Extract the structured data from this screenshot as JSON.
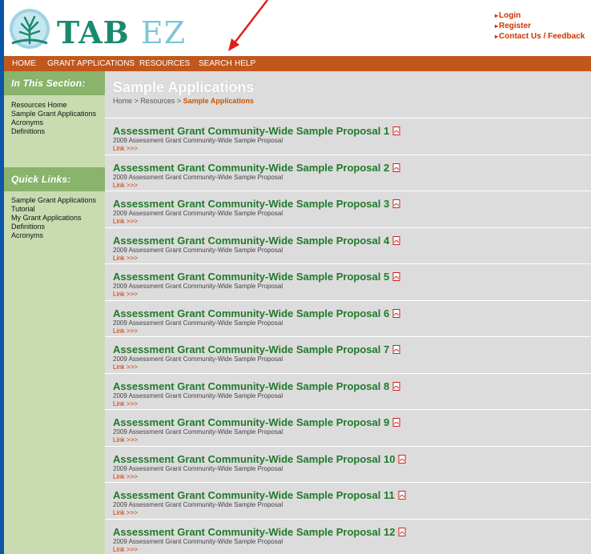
{
  "header": {
    "logo_main": "TAB",
    "logo_ez": "EZ",
    "top_links": [
      "Login",
      "Register",
      "Contact Us / Feedback"
    ]
  },
  "nav": {
    "items": [
      "HOME",
      "GRANT APPLICATIONS",
      "RESOURCES",
      "SEARCH",
      "HELP"
    ]
  },
  "sidebar": {
    "section_heading": "In This Section:",
    "section_links": [
      "Resources Home",
      "Sample Grant Applications",
      "Acronyms",
      "Definitions"
    ],
    "quick_heading": "Quick Links:",
    "quick_links": [
      "Sample Grant Applications",
      "Tutorial",
      "My Grant Applications",
      "Definitions",
      "Acronyms"
    ]
  },
  "main": {
    "title": "Sample Applications",
    "breadcrumb": {
      "home": "Home",
      "sep": ">",
      "resources": "Resources",
      "current": "Sample Applications"
    },
    "items": [
      {
        "title": "Assessment Grant Community-Wide Sample Proposal 1",
        "desc": "2009 Assessment Grant Community-Wide Sample Proposal",
        "link": "Link >>>"
      },
      {
        "title": "Assessment Grant Community-Wide Sample Proposal 2",
        "desc": "2009 Assessment Grant Community-Wide Sample Proposal",
        "link": "Link >>>"
      },
      {
        "title": "Assessment Grant Community-Wide Sample Proposal 3",
        "desc": "2009 Assessment Grant Community-Wide Sample Proposal",
        "link": "Link >>>"
      },
      {
        "title": "Assessment Grant Community-Wide Sample Proposal 4",
        "desc": "2009 Assessment Grant Community-Wide Sample Proposal",
        "link": "Link >>>"
      },
      {
        "title": "Assessment Grant Community-Wide Sample Proposal 5",
        "desc": "2009 Assessment Grant Community-Wide Sample Proposal",
        "link": "Link >>>"
      },
      {
        "title": "Assessment Grant Community-Wide Sample Proposal 6",
        "desc": "2009 Assessment Grant Community-Wide Sample Proposal",
        "link": "Link >>>"
      },
      {
        "title": "Assessment Grant Community-Wide Sample Proposal 7",
        "desc": "2009 Assessment Grant Community-Wide Sample Proposal",
        "link": "Link >>>"
      },
      {
        "title": "Assessment Grant Community-Wide Sample Proposal 8",
        "desc": "2009 Assessment Grant Community-Wide Sample Proposal",
        "link": "Link >>>"
      },
      {
        "title": "Assessment Grant Community-Wide Sample Proposal 9",
        "desc": "2009 Assessment Grant Community-Wide Sample Proposal",
        "link": "Link >>>"
      },
      {
        "title": "Assessment Grant Community-Wide Sample Proposal 10",
        "desc": "2009 Assessment Grant Community-Wide Sample Proposal",
        "link": "Link >>>"
      },
      {
        "title": "Assessment Grant Community-Wide Sample Proposal 11",
        "desc": "2009 Assessment Grant Community-Wide Sample Proposal",
        "link": "Link >>>"
      },
      {
        "title": "Assessment Grant Community-Wide Sample Proposal 12",
        "desc": "2009 Assessment Grant Community-Wide Sample Proposal",
        "link": "Link >>>"
      }
    ]
  },
  "colors": {
    "outer_border": "#0b56a8",
    "nav_bg": "#c2571d",
    "sidebar_bg": "#c8dcb0",
    "sidebar_heading_bg": "#8ab36c",
    "content_bg": "#dcdcdc",
    "item_title": "#1f7a2a",
    "link_red": "#cc3300"
  },
  "icons": {
    "logo": "tree-logo-icon",
    "pdf": "pdf-icon",
    "annotation": "red-arrow-annotation-icon"
  }
}
